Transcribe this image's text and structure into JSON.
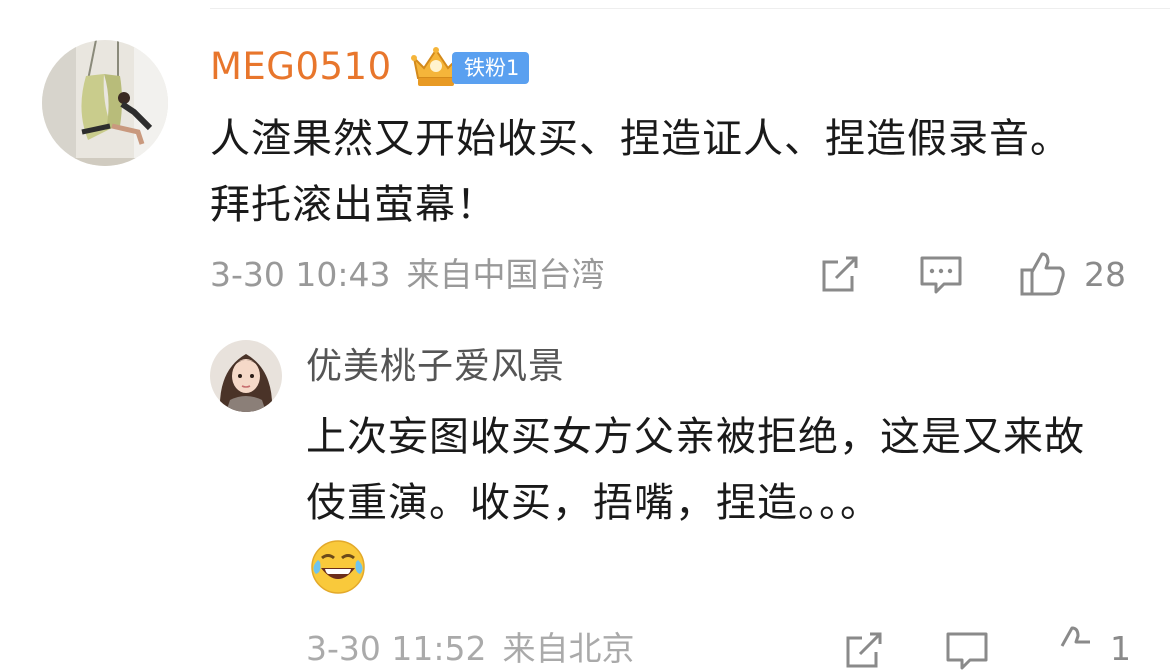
{
  "comment": {
    "username": "MEG0510",
    "badge": "铁粉1",
    "text": "人渣果然又开始收买、捏造证人、捏造假录音。拜托滚出萤幕！",
    "date": "3-30 10:43",
    "location": "来自中国台湾",
    "like_count": "28",
    "icons": [
      "crown-badge-icon",
      "share-icon",
      "comment-icon",
      "like-icon"
    ]
  },
  "reply": {
    "username": "优美桃子爱风景",
    "text": "上次妄图收买女方父亲被拒绝，这是又来故伎重演。收买，捂嘴，捏造。。。",
    "emoji": "laugh-cry-emoji",
    "date": "3-30 11:52",
    "location": "来自北京",
    "like_count": "1"
  },
  "colors": {
    "username_main": "#e8762c",
    "badge_bg": "#5aa0f0",
    "meta": "#999999",
    "icon": "#8a8a8a"
  }
}
